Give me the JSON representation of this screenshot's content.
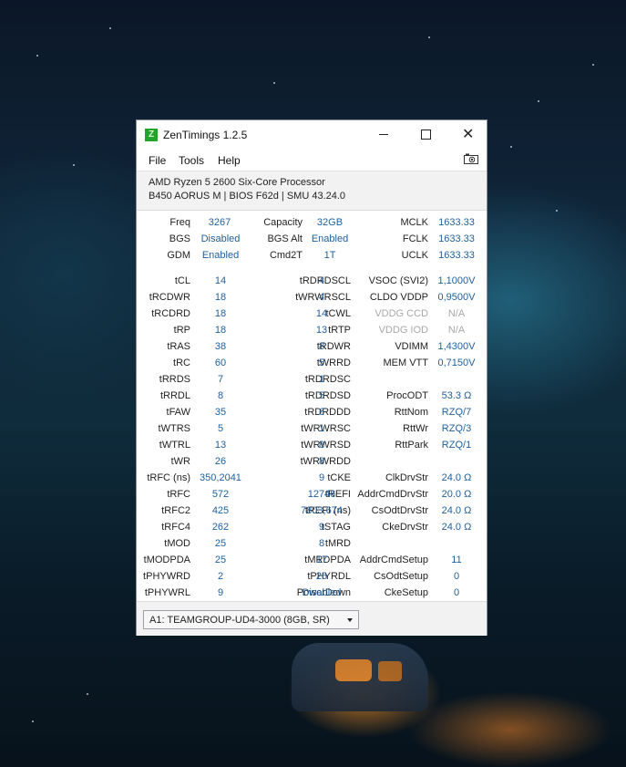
{
  "app": {
    "title": "ZenTimings 1.2.5",
    "icon_letter": "Z"
  },
  "menu": {
    "file": "File",
    "tools": "Tools",
    "help": "Help"
  },
  "system": {
    "cpu": "AMD Ryzen 5 2600 Six-Core Processor",
    "board": "B450 AORUS M | BIOS F62d | SMU 43.24.0"
  },
  "top": {
    "freq": {
      "label": "Freq",
      "value": "3267"
    },
    "capacity": {
      "label": "Capacity",
      "value": "32GB"
    },
    "mclk": {
      "label": "MCLK",
      "value": "1633.33"
    },
    "bgs": {
      "label": "BGS",
      "value": "Disabled"
    },
    "bgs_alt": {
      "label": "BGS Alt",
      "value": "Enabled"
    },
    "fclk": {
      "label": "FCLK",
      "value": "1633.33"
    },
    "gdm": {
      "label": "GDM",
      "value": "Enabled"
    },
    "cmd2t": {
      "label": "Cmd2T",
      "value": "1T"
    },
    "uclk": {
      "label": "UCLK",
      "value": "1633.33"
    }
  },
  "col1": [
    {
      "label": "tCL",
      "value": "14"
    },
    {
      "label": "tRCDWR",
      "value": "18"
    },
    {
      "label": "tRCDRD",
      "value": "18"
    },
    {
      "label": "tRP",
      "value": "18"
    },
    {
      "label": "tRAS",
      "value": "38"
    },
    {
      "label": "tRC",
      "value": "60"
    },
    {
      "label": "tRRDS",
      "value": "7"
    },
    {
      "label": "tRRDL",
      "value": "8"
    },
    {
      "label": "tFAW",
      "value": "35"
    },
    {
      "label": "tWTRS",
      "value": "5"
    },
    {
      "label": "tWTRL",
      "value": "13"
    },
    {
      "label": "tWR",
      "value": "26"
    },
    {
      "label": "tRFC (ns)",
      "value": "350,2041"
    },
    {
      "label": "tRFC",
      "value": "572"
    },
    {
      "label": "tRFC2",
      "value": "425"
    },
    {
      "label": "tRFC4",
      "value": "262"
    },
    {
      "label": "tMOD",
      "value": "25"
    },
    {
      "label": "tMODPDA",
      "value": "25"
    },
    {
      "label": "tPHYWRD",
      "value": "2"
    },
    {
      "label": "tPHYWRL",
      "value": "9"
    }
  ],
  "col2": [
    {
      "label": "tRDRDSCL",
      "value": "4"
    },
    {
      "label": "tWRWRSCL",
      "value": "4"
    },
    {
      "label": "tCWL",
      "value": "14"
    },
    {
      "label": "tRTP",
      "value": "13"
    },
    {
      "label": "tRDWR",
      "value": "8"
    },
    {
      "label": "tWRRD",
      "value": "5"
    },
    {
      "label": "tRDRDSC",
      "value": "1"
    },
    {
      "label": "tRDRDSD",
      "value": "5"
    },
    {
      "label": "tRDRDDD",
      "value": "6"
    },
    {
      "label": "tWRWRSC",
      "value": "1"
    },
    {
      "label": "tWRWRSD",
      "value": "8"
    },
    {
      "label": "tWRWRDD",
      "value": "8"
    },
    {
      "label": "tCKE",
      "value": "9"
    },
    {
      "label": "tREFI",
      "value": "12746"
    },
    {
      "label": "tREFI (ns)",
      "value": "7803,674"
    },
    {
      "label": "tSTAG",
      "value": "9"
    },
    {
      "label": "tMRD",
      "value": "8"
    },
    {
      "label": "tMRDPDA",
      "value": "17"
    },
    {
      "label": "tPHYRDL",
      "value": "26"
    },
    {
      "label": "PowerDown",
      "value": "Disabled"
    }
  ],
  "col3": [
    {
      "label": "VSOC (SVI2)",
      "value": "1,1000V"
    },
    {
      "label": "CLDO VDDP",
      "value": "0,9500V"
    },
    {
      "label": "VDDG CCD",
      "value": "N/A",
      "dim": true
    },
    {
      "label": "VDDG IOD",
      "value": "N/A",
      "dim": true
    },
    {
      "label": "VDIMM",
      "value": "1,4300V"
    },
    {
      "label": "MEM VTT",
      "value": "0,7150V"
    },
    {
      "label": "",
      "value": ""
    },
    {
      "label": "ProcODT",
      "value": "53.3 Ω"
    },
    {
      "label": "RttNom",
      "value": "RZQ/7"
    },
    {
      "label": "RttWr",
      "value": "RZQ/3"
    },
    {
      "label": "RttPark",
      "value": "RZQ/1"
    },
    {
      "label": "",
      "value": ""
    },
    {
      "label": "ClkDrvStr",
      "value": "24.0 Ω"
    },
    {
      "label": "AddrCmdDrvStr",
      "value": "20.0 Ω"
    },
    {
      "label": "CsOdtDrvStr",
      "value": "24.0 Ω"
    },
    {
      "label": "CkeDrvStr",
      "value": "24.0 Ω"
    },
    {
      "label": "",
      "value": ""
    },
    {
      "label": "AddrCmdSetup",
      "value": "11"
    },
    {
      "label": "CsOdtSetup",
      "value": "0"
    },
    {
      "label": "CkeSetup",
      "value": "0"
    }
  ],
  "footer": {
    "module": "A1: TEAMGROUP-UD4-3000 (8GB, SR)"
  }
}
